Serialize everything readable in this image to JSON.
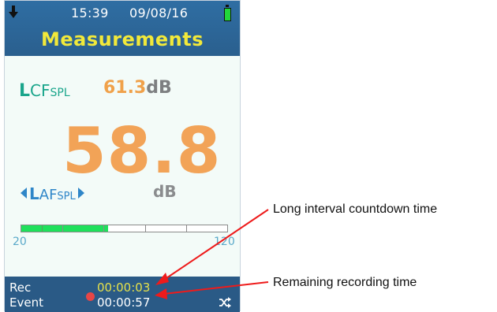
{
  "status": {
    "time": "15:39",
    "date": "09/08/16",
    "download_icon": "down-arrow-icon",
    "battery_icon": "battery-full-icon",
    "battery_color": "#22d63a"
  },
  "header": {
    "title": "Measurements"
  },
  "secondary": {
    "label_big": "L",
    "label_mid": "CF",
    "label_sub": "SPL",
    "value": "61.3",
    "unit": "dB"
  },
  "main": {
    "value": "58.8",
    "label_big": "L",
    "label_mid": "AF",
    "label_sub": "SPL",
    "unit": "dB"
  },
  "level_bar": {
    "min_label": "20",
    "max_label": "120",
    "fill_fraction": 0.42,
    "segments": 5
  },
  "footer": {
    "rec_label": "Rec",
    "event_label": "Event",
    "countdown_time": "00:00:03",
    "remaining_time": "00:00:57",
    "record_indicator_color": "#e74646",
    "shuffle_icon": "shuffle-icon"
  },
  "annotations": {
    "countdown": "Long interval countdown time",
    "remaining": "Remaining recording time",
    "arrow_color": "#ee1b1b"
  }
}
